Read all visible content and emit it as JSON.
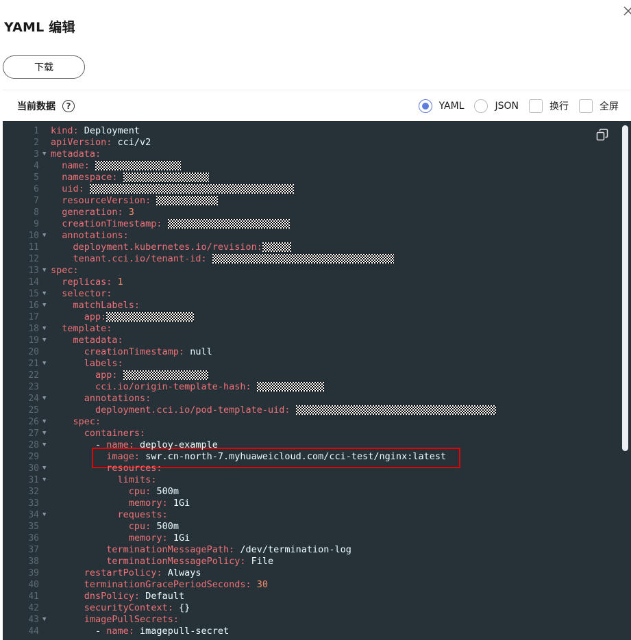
{
  "dialog": {
    "title": "YAML 编辑"
  },
  "toolbar": {
    "download_label": "下载",
    "current_data_label": "当前数据",
    "help_icon": "?",
    "options": [
      {
        "label": "YAML",
        "type": "radio",
        "checked": true
      },
      {
        "label": "JSON",
        "type": "radio",
        "checked": false
      },
      {
        "label": "换行",
        "type": "checkbox",
        "checked": false
      },
      {
        "label": "全屏",
        "type": "checkbox",
        "checked": false
      }
    ]
  },
  "colors": {
    "accent": "#5e7ce0",
    "editor_bg": "#263238",
    "key": "#f07178",
    "number": "#f78c6c",
    "highlight": "#e60000"
  },
  "icons": {
    "close": "close-icon",
    "help": "help-icon",
    "copy": "copy-icon"
  },
  "editor": {
    "lines": [
      {
        "n": "1",
        "fold": false,
        "key": "kind:",
        "val": " Deployment"
      },
      {
        "n": "2",
        "fold": false,
        "key": "apiVersion:",
        "val": " cci/v2"
      },
      {
        "n": "3",
        "fold": true,
        "key": "metadata:",
        "val": ""
      },
      {
        "n": "4",
        "fold": false,
        "indent": "  ",
        "key": "name:",
        "val": " ",
        "redacted": 125
      },
      {
        "n": "5",
        "fold": false,
        "indent": "  ",
        "key": "namespace:",
        "val": " ",
        "redacted": 125
      },
      {
        "n": "6",
        "fold": false,
        "indent": "  ",
        "key": "uid:",
        "val": " ",
        "redacted": 298
      },
      {
        "n": "7",
        "fold": false,
        "indent": "  ",
        "key": "resourceVersion:",
        "val": " ",
        "redacted": 90
      },
      {
        "n": "8",
        "fold": false,
        "indent": "  ",
        "key": "generation:",
        "num": " 3"
      },
      {
        "n": "9",
        "fold": false,
        "indent": "  ",
        "key": "creationTimestamp:",
        "val": " ",
        "redacted": 178
      },
      {
        "n": "10",
        "fold": true,
        "indent": "  ",
        "key": "annotations:",
        "val": ""
      },
      {
        "n": "11",
        "fold": false,
        "indent": "    ",
        "key": "deployment.kubernetes.io/revision:",
        "val": "",
        "redacted": 42
      },
      {
        "n": "12",
        "fold": false,
        "indent": "    ",
        "key": "tenant.cci.io/tenant-id:",
        "val": " ",
        "redacted": 265
      },
      {
        "n": "13",
        "fold": true,
        "key": "spec:",
        "val": ""
      },
      {
        "n": "14",
        "fold": false,
        "indent": "  ",
        "key": "replicas:",
        "num": " 1"
      },
      {
        "n": "15",
        "fold": true,
        "indent": "  ",
        "key": "selector:",
        "val": ""
      },
      {
        "n": "16",
        "fold": true,
        "indent": "    ",
        "key": "matchLabels:",
        "val": ""
      },
      {
        "n": "17",
        "fold": false,
        "indent": "      ",
        "key": "app:",
        "val": "",
        "redacted": 128
      },
      {
        "n": "18",
        "fold": true,
        "indent": "  ",
        "key": "template:",
        "val": ""
      },
      {
        "n": "19",
        "fold": true,
        "indent": "    ",
        "key": "metadata:",
        "val": ""
      },
      {
        "n": "20",
        "fold": false,
        "indent": "      ",
        "key": "creationTimestamp:",
        "val": " null"
      },
      {
        "n": "21",
        "fold": true,
        "indent": "      ",
        "key": "labels:",
        "val": ""
      },
      {
        "n": "22",
        "fold": false,
        "indent": "        ",
        "key": "app:",
        "val": " ",
        "redacted": 124
      },
      {
        "n": "23",
        "fold": false,
        "indent": "        ",
        "key": "cci.io/origin-template-hash:",
        "val": " ",
        "redacted": 98
      },
      {
        "n": "24",
        "fold": true,
        "indent": "      ",
        "key": "annotations:",
        "val": ""
      },
      {
        "n": "25",
        "fold": false,
        "indent": "        ",
        "key": "deployment.cci.io/pod-template-uid:",
        "val": " ",
        "redacted": 292
      },
      {
        "n": "26",
        "fold": true,
        "indent": "    ",
        "key": "spec:",
        "val": ""
      },
      {
        "n": "27",
        "fold": true,
        "indent": "      ",
        "key": "containers:",
        "val": ""
      },
      {
        "n": "28",
        "fold": true,
        "indent": "        - ",
        "key": "name:",
        "val": " deploy-example"
      },
      {
        "n": "29",
        "fold": false,
        "indent": "          ",
        "key": "image:",
        "val": " swr.cn-north-7.myhuaweicloud.com/cci-test/nginx:latest"
      },
      {
        "n": "30",
        "fold": true,
        "indent": "          ",
        "key": "resources:",
        "val": ""
      },
      {
        "n": "31",
        "fold": true,
        "indent": "            ",
        "key": "limits:",
        "val": ""
      },
      {
        "n": "32",
        "fold": false,
        "indent": "              ",
        "key": "cpu:",
        "val": " 500m"
      },
      {
        "n": "33",
        "fold": false,
        "indent": "              ",
        "key": "memory:",
        "val": " 1Gi"
      },
      {
        "n": "34",
        "fold": true,
        "indent": "            ",
        "key": "requests:",
        "val": ""
      },
      {
        "n": "35",
        "fold": false,
        "indent": "              ",
        "key": "cpu:",
        "val": " 500m"
      },
      {
        "n": "36",
        "fold": false,
        "indent": "              ",
        "key": "memory:",
        "val": " 1Gi"
      },
      {
        "n": "37",
        "fold": false,
        "indent": "          ",
        "key": "terminationMessagePath:",
        "val": " /dev/termination-log"
      },
      {
        "n": "38",
        "fold": false,
        "indent": "          ",
        "key": "terminationMessagePolicy:",
        "val": " File"
      },
      {
        "n": "39",
        "fold": false,
        "indent": "      ",
        "key": "restartPolicy:",
        "val": " Always"
      },
      {
        "n": "40",
        "fold": false,
        "indent": "      ",
        "key": "terminationGracePeriodSeconds:",
        "num": " 30"
      },
      {
        "n": "41",
        "fold": false,
        "indent": "      ",
        "key": "dnsPolicy:",
        "val": " Default"
      },
      {
        "n": "42",
        "fold": false,
        "indent": "      ",
        "key": "securityContext:",
        "val": " {}"
      },
      {
        "n": "43",
        "fold": true,
        "indent": "      ",
        "key": "imagePullSecrets:",
        "val": ""
      },
      {
        "n": "44",
        "fold": false,
        "indent": "        - ",
        "key": "name:",
        "val": " imagepull-secret"
      }
    ]
  }
}
